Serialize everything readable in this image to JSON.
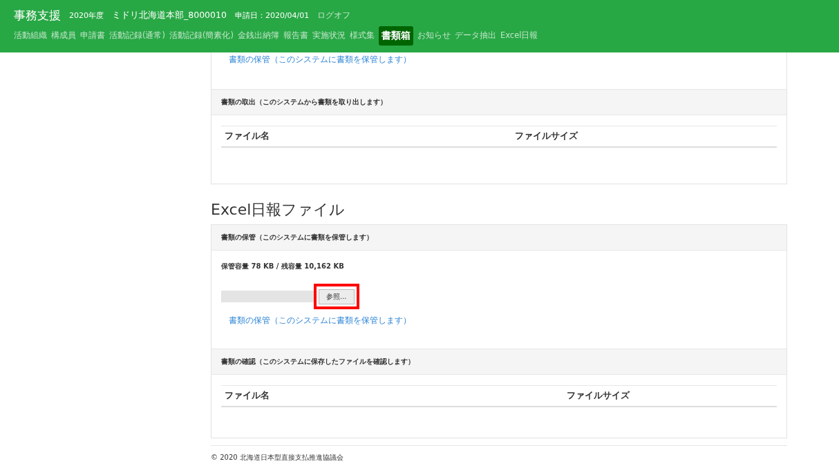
{
  "header": {
    "brand": "事務支援",
    "fiscal_year": "2020年度",
    "organization": "ミドリ北海道本部_8000010",
    "application_date": "申請日：2020/04/01",
    "logout": "ログオフ",
    "nav": [
      {
        "label": "活動組織",
        "selected": false
      },
      {
        "label": "構成員",
        "selected": false
      },
      {
        "label": "申請書",
        "selected": false
      },
      {
        "label": "活動記録(通常)",
        "selected": false
      },
      {
        "label": "活動記録(簡素化)",
        "selected": false
      },
      {
        "label": "金銭出納簿",
        "selected": false
      },
      {
        "label": "報告書",
        "selected": false
      },
      {
        "label": "実施状況",
        "selected": false
      },
      {
        "label": "様式集",
        "selected": false
      },
      {
        "label": "書類箱",
        "selected": true
      },
      {
        "label": "お知らせ",
        "selected": false
      },
      {
        "label": "データ抽出",
        "selected": false
      },
      {
        "label": "Excel日報",
        "selected": false
      }
    ]
  },
  "top_card": {
    "store_link": "書類の保管（このシステムに書類を保管します）",
    "retrieve_section": {
      "title": "書類の取出（このシステムから書類を取り出します）",
      "columns": [
        "ファイル名",
        "ファイルサイズ"
      ]
    }
  },
  "excel_section": {
    "heading": "Excel日報ファイル",
    "store_section": {
      "title": "書類の保管（このシステムに書類を保管します）",
      "capacity": "保管容量 78 KB / 残容量 10,162 KB",
      "browse_button": {
        "label": "参照...",
        "highlighted": true
      },
      "store_link": "書類の保管（このシステムに書類を保管します）"
    },
    "confirm_section": {
      "title": "書類の確認（このシステムに保存したファイルを確認します）",
      "columns": [
        "ファイル名",
        "ファイルサイズ"
      ]
    }
  },
  "footer": "© 2020 北海道日本型直接支払推進協議会"
}
